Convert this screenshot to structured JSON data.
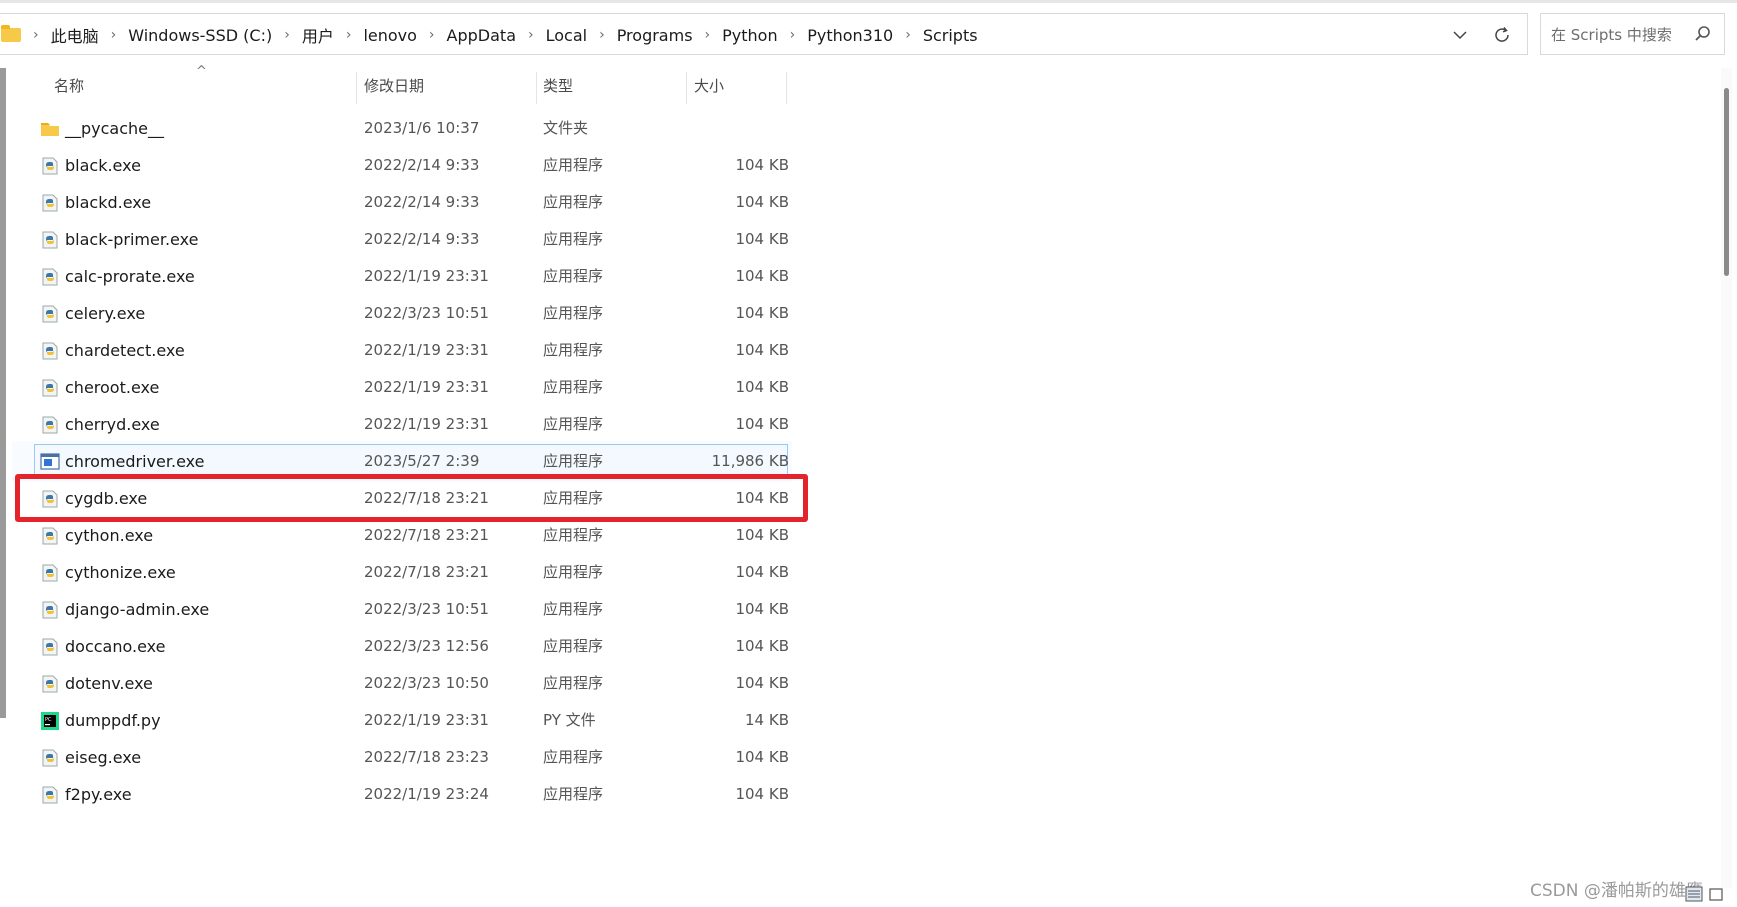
{
  "address": {
    "crumbs": [
      "此电脑",
      "Windows-SSD (C:)",
      "用户",
      "lenovo",
      "AppData",
      "Local",
      "Programs",
      "Python",
      "Python310",
      "Scripts"
    ]
  },
  "search": {
    "placeholder": "在 Scripts 中搜索"
  },
  "columns": {
    "name": "名称",
    "date": "修改日期",
    "type": "类型",
    "size": "大小"
  },
  "rows": [
    {
      "name": "__pycache__",
      "date": "2023/1/6 10:37",
      "type": "文件夹",
      "size": "",
      "icon": "folder-icon"
    },
    {
      "name": "black.exe",
      "date": "2022/2/14 9:33",
      "type": "应用程序",
      "size": "104 KB",
      "icon": "python-exe-icon"
    },
    {
      "name": "blackd.exe",
      "date": "2022/2/14 9:33",
      "type": "应用程序",
      "size": "104 KB",
      "icon": "python-exe-icon"
    },
    {
      "name": "black-primer.exe",
      "date": "2022/2/14 9:33",
      "type": "应用程序",
      "size": "104 KB",
      "icon": "python-exe-icon"
    },
    {
      "name": "calc-prorate.exe",
      "date": "2022/1/19 23:31",
      "type": "应用程序",
      "size": "104 KB",
      "icon": "python-exe-icon"
    },
    {
      "name": "celery.exe",
      "date": "2022/3/23 10:51",
      "type": "应用程序",
      "size": "104 KB",
      "icon": "python-exe-icon"
    },
    {
      "name": "chardetect.exe",
      "date": "2022/1/19 23:31",
      "type": "应用程序",
      "size": "104 KB",
      "icon": "python-exe-icon"
    },
    {
      "name": "cheroot.exe",
      "date": "2022/1/19 23:31",
      "type": "应用程序",
      "size": "104 KB",
      "icon": "python-exe-icon"
    },
    {
      "name": "cherryd.exe",
      "date": "2022/1/19 23:31",
      "type": "应用程序",
      "size": "104 KB",
      "icon": "python-exe-icon"
    },
    {
      "name": "chromedriver.exe",
      "date": "2023/5/27 2:39",
      "type": "应用程序",
      "size": "11,986 KB",
      "icon": "app-window-icon",
      "selected": true
    },
    {
      "name": "cygdb.exe",
      "date": "2022/7/18 23:21",
      "type": "应用程序",
      "size": "104 KB",
      "icon": "python-exe-icon"
    },
    {
      "name": "cython.exe",
      "date": "2022/7/18 23:21",
      "type": "应用程序",
      "size": "104 KB",
      "icon": "python-exe-icon"
    },
    {
      "name": "cythonize.exe",
      "date": "2022/7/18 23:21",
      "type": "应用程序",
      "size": "104 KB",
      "icon": "python-exe-icon"
    },
    {
      "name": "django-admin.exe",
      "date": "2022/3/23 10:51",
      "type": "应用程序",
      "size": "104 KB",
      "icon": "python-exe-icon"
    },
    {
      "name": "doccano.exe",
      "date": "2022/3/23 12:56",
      "type": "应用程序",
      "size": "104 KB",
      "icon": "python-exe-icon"
    },
    {
      "name": "dotenv.exe",
      "date": "2022/3/23 10:50",
      "type": "应用程序",
      "size": "104 KB",
      "icon": "python-exe-icon"
    },
    {
      "name": "dumppdf.py",
      "date": "2022/1/19 23:31",
      "type": "PY 文件",
      "size": "14 KB",
      "icon": "pycharm-file-icon"
    },
    {
      "name": "eiseg.exe",
      "date": "2022/7/18 23:23",
      "type": "应用程序",
      "size": "104 KB",
      "icon": "python-exe-icon"
    },
    {
      "name": "f2py.exe",
      "date": "2022/1/19 23:24",
      "type": "应用程序",
      "size": "104 KB",
      "icon": "python-exe-icon"
    }
  ],
  "watermark": "CSDN @潘帕斯的雄鹰"
}
